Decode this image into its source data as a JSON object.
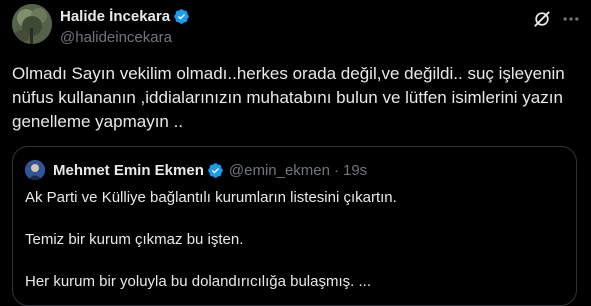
{
  "author": {
    "name": "Halide İncekara",
    "handle": "@halideincekara"
  },
  "tweet": {
    "text": "Olmadı Sayın vekilim olmadı..herkes orada değil,ve değildi.. suç işleyenin nüfus kullananın ,iddialarınızın muhatabını bulun ve lütfen isimlerini yazın genelleme yapmayın .."
  },
  "quote": {
    "name": "Mehmet Emin Ekmen",
    "handle": "@emin_ekmen",
    "separator": "·",
    "time": "19s",
    "lines": [
      "Ak Parti ve Külliye bağlantılı kurumların listesini çıkartın.",
      "Temiz bir kurum çıkmaz bu işten.",
      "Her kurum bir yoluyla bu dolandırıcılığa bulaşmış. ..."
    ]
  },
  "icons": {
    "verified": "verified-badge-icon",
    "grok": "grok-icon",
    "more": "more-options-icon"
  },
  "colors": {
    "background": "#000000",
    "primary_text": "#e7e9ea",
    "secondary_text": "#71767b",
    "verified_blue": "#1d9bf0",
    "border": "#2f3336"
  }
}
